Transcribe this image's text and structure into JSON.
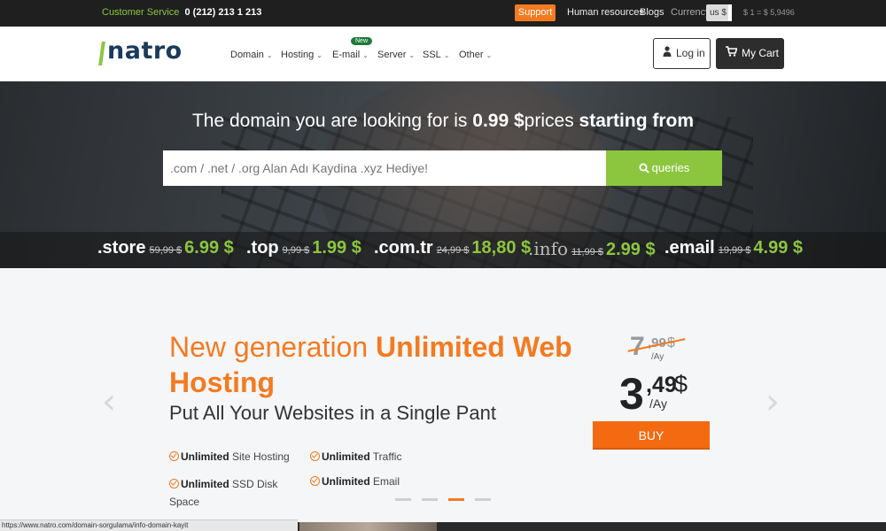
{
  "topbar": {
    "customer_service_label": "Customer Service",
    "phone": "0 (212) 213 1 213",
    "support_label": "Support",
    "links": [
      "Human resources",
      "Blogs",
      "Currency"
    ],
    "currency_value": "us $",
    "rate": "$ 1 = $ 5,9496"
  },
  "brand": {
    "logo_text": "natro"
  },
  "nav": {
    "items": [
      "Domain",
      "Hosting",
      "E-mail",
      "Server",
      "SSL",
      "Other"
    ],
    "new_badge": "New",
    "login_label": "Log in",
    "cart_label": "My Cart"
  },
  "hero": {
    "headline_pre": "The domain you are looking for is ",
    "headline_price": "0.99 $",
    "headline_mid": "prices ",
    "headline_post": "starting from",
    "search_placeholder": ".com / .net / .org Alan Adı Kaydina .xyz Hediye!",
    "search_button": "queries",
    "tlds": [
      {
        "name": ".store",
        "old": "59,99 $",
        "new": "6.99 $"
      },
      {
        "name": ".top",
        "old": "9,99 $",
        "new": "1.99 $"
      },
      {
        "name": ".com.tr",
        "old": "24,99 $",
        "new": "18,80 $"
      },
      {
        "name": ".info",
        "old": "11,99 $",
        "new": "2.99 $"
      },
      {
        "name": ".email",
        "old": "19,99 $",
        "new": "4.99 $"
      }
    ]
  },
  "promo": {
    "title_light": "New generation ",
    "title_bold": "Unlimited Web Hosting",
    "subtitle": "Put All Your Websites in a Single Pant",
    "features": [
      {
        "bold": "Unlimited",
        "rest": " Site Hosting"
      },
      {
        "bold": "Unlimited",
        "rest": " Traffic"
      },
      {
        "bold": "Unlimited",
        "rest": " SSD Disk Space"
      },
      {
        "bold": "Unlimited",
        "rest": " Email"
      }
    ],
    "old_price": {
      "int": "7",
      "dec": ",99",
      "cur": "$",
      "per": "/Ay"
    },
    "new_price": {
      "int": "3",
      "dec": ",49",
      "cur": "$",
      "per": "/Ay"
    },
    "buy_label": "BUY",
    "slides_total": 4,
    "slide_active": 3
  },
  "status_url": "https://www.natro.com/domain-sorgulama/info-domain-kayit",
  "colors": {
    "accent": "#f47a20",
    "green": "#8cc63f",
    "dark": "#1f1f1f",
    "navy": "#1b3a5c"
  }
}
